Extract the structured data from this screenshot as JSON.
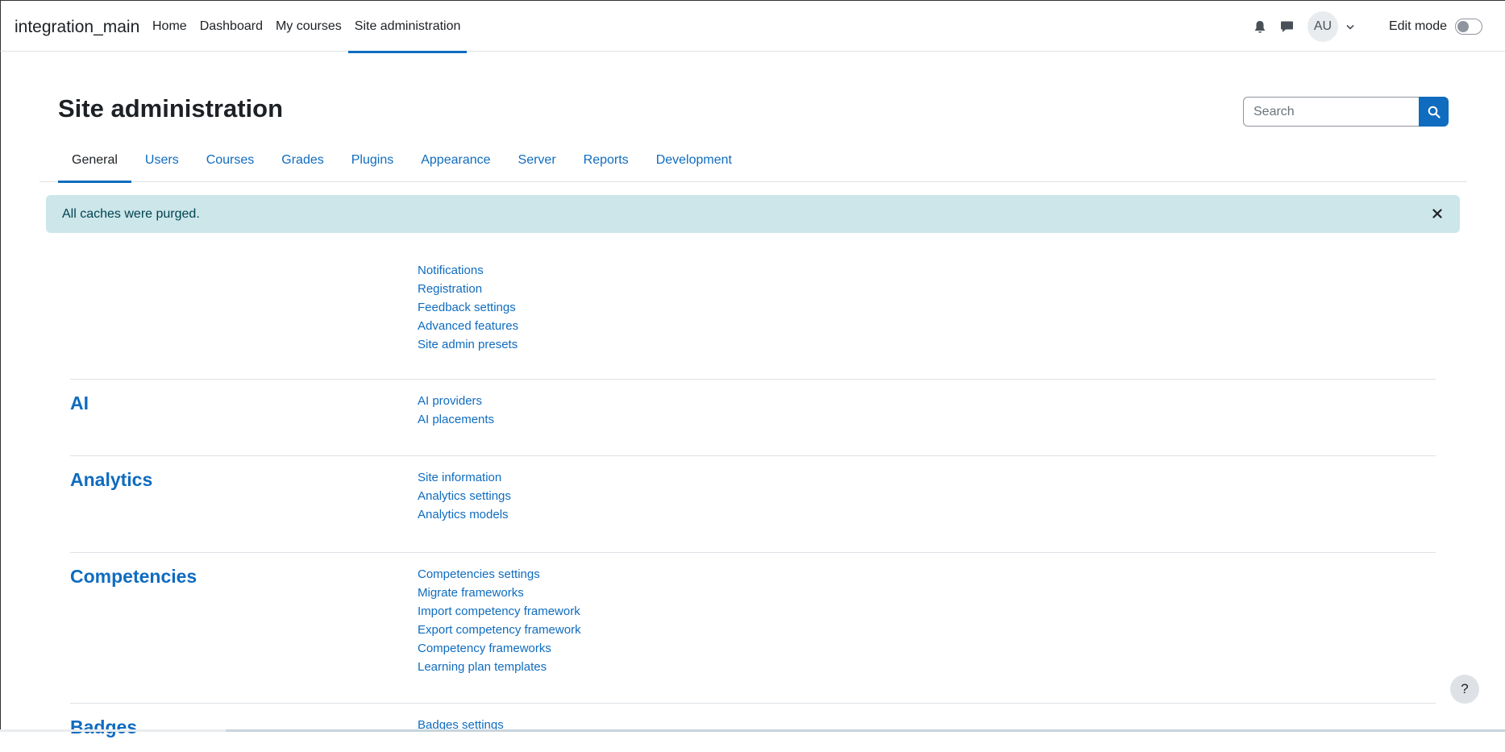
{
  "navbar": {
    "brand": "integration_main",
    "items": [
      {
        "label": "Home",
        "active": false
      },
      {
        "label": "Dashboard",
        "active": false
      },
      {
        "label": "My courses",
        "active": false
      },
      {
        "label": "Site administration",
        "active": true
      }
    ],
    "avatar_initials": "AU",
    "edit_mode_label": "Edit mode",
    "icons": {
      "notifications": "bell-icon",
      "messages": "message-icon",
      "user_menu": "chevron-down-icon"
    }
  },
  "page": {
    "title": "Site administration",
    "search_placeholder": "Search"
  },
  "tabs": [
    {
      "label": "General",
      "active": true
    },
    {
      "label": "Users",
      "active": false
    },
    {
      "label": "Courses",
      "active": false
    },
    {
      "label": "Grades",
      "active": false
    },
    {
      "label": "Plugins",
      "active": false
    },
    {
      "label": "Appearance",
      "active": false
    },
    {
      "label": "Server",
      "active": false
    },
    {
      "label": "Reports",
      "active": false
    },
    {
      "label": "Development",
      "active": false
    }
  ],
  "alert": {
    "message": "All caches were purged."
  },
  "sections": [
    {
      "heading": "",
      "links": [
        "Notifications",
        "Registration",
        "Feedback settings",
        "Advanced features",
        "Site admin presets"
      ]
    },
    {
      "heading": "AI",
      "links": [
        "AI providers",
        "AI placements"
      ]
    },
    {
      "heading": "Analytics",
      "links": [
        "Site information",
        "Analytics settings",
        "Analytics models"
      ]
    },
    {
      "heading": "Competencies",
      "links": [
        "Competencies settings",
        "Migrate frameworks",
        "Import competency framework",
        "Export competency framework",
        "Competency frameworks",
        "Learning plan templates"
      ]
    },
    {
      "heading": "Badges",
      "links": [
        "Badges settings"
      ]
    }
  ],
  "help_button": "?",
  "colors": {
    "primary": "#0f6cbf",
    "alert_bg": "#cce6ea",
    "alert_text": "#00434e"
  }
}
